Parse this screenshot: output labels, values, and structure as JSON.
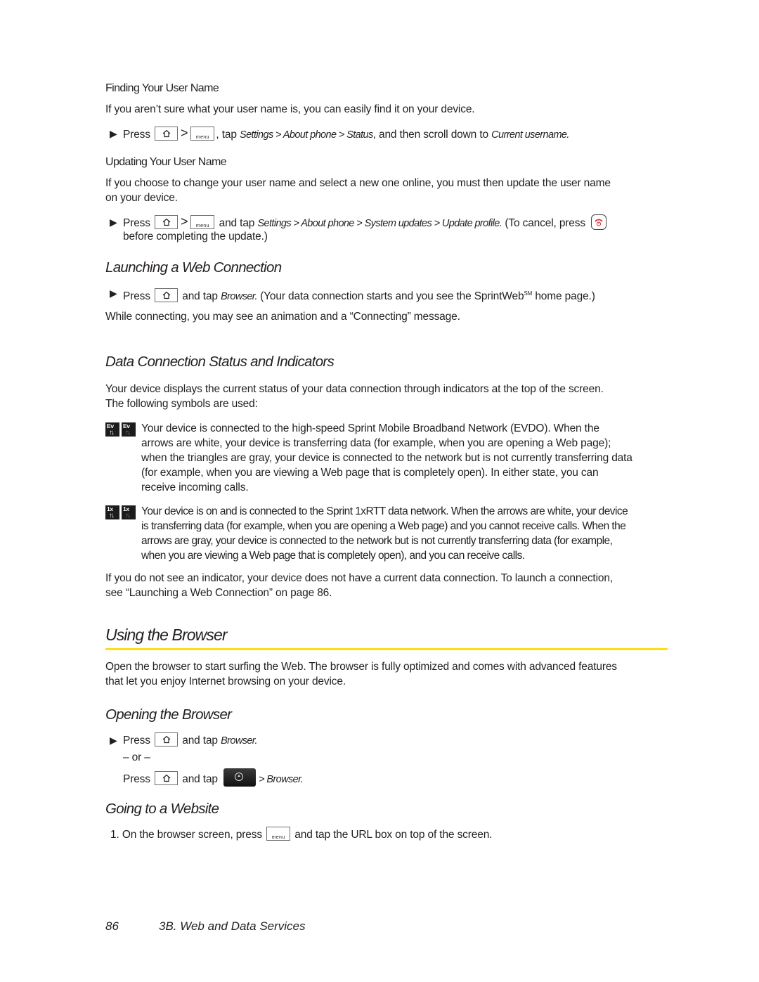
{
  "sections": {
    "finding": {
      "heading": "Finding Your User Name",
      "intro": "If you aren’t sure what your user name is, you can easily find it on your device.",
      "step": {
        "press": "Press",
        "home_key": "home-key",
        "sep": ">",
        "menu_key": "menu",
        "tap": ", tap",
        "path": "Settings > About phone > Status",
        "rest": ", and then scroll down to",
        "target": "Current username."
      }
    },
    "updating": {
      "heading": "Updating Your User Name",
      "intro_line1": "If you choose to change your user name and select a new one online, you must then update the user name",
      "intro_line2": "on your device.",
      "step": {
        "press": "Press",
        "sep": ">",
        "menu_key": "menu",
        "tap": "and tap",
        "path": "Settings > About phone > System updates > Update profile.",
        "cancel": "(To cancel, press",
        "line2": "before completing the update.)"
      }
    },
    "launching": {
      "heading": "Launching a Web Connection",
      "step": {
        "press": "Press",
        "tap": "and tap",
        "target": "Browser.",
        "rest": "(Your data connection starts and you see the SprintWeb",
        "sup": "SM",
        "rest2": "home page.)"
      },
      "note": "While connecting, you may see an animation and a “Connecting” message."
    },
    "status": {
      "heading": "Data Connection Status and Indicators",
      "intro_line1": "Your device displays the current status of your data connection through indicators at the top of the screen.",
      "intro_line2": "The following symbols are used:",
      "indicators": [
        {
          "label": "Ev",
          "lines": [
            "Your device is connected to the high-speed Sprint Mobile Broadband Network (EVDO). When the",
            "arrows are white, your device is transferring data (for example, when you are opening a Web page);",
            "when the triangles are gray, your device is connected to the network but is not currently transferring data",
            "(for example, when you are viewing a Web page that is completely open). In either state, you can",
            "receive incoming calls."
          ]
        },
        {
          "label": "1x",
          "lines": [
            "Your device is on and is connected to the Sprint 1xRTT data network. When the arrows are white, your device",
            "is transferring data (for example, when you are opening a Web page) and you cannot receive calls. When the",
            "arrows are gray, your device is connected to the network but is not currently transferring data (for example,",
            "when you are viewing a Web page that is completely open), and you can receive calls."
          ]
        }
      ],
      "outro_line1": "If you do not see an indicator, your device does not have a current data connection. To launch a connection,",
      "outro_line2": "see “Launching a Web Connection” on page 86."
    },
    "using": {
      "heading": "Using the Browser",
      "rule_color": "#ffde17",
      "intro_line1": "Open the browser to start surfing the Web. The browser is fully optimized and comes with advanced features",
      "intro_line2": "that let you enjoy Internet browsing on your device."
    },
    "opening": {
      "heading": "Opening the Browser",
      "step1": {
        "press": "Press",
        "tap": "and tap",
        "target": "Browser."
      },
      "or": "– or –",
      "step2": {
        "press": "Press",
        "tap": "and tap",
        "target": "> Browser."
      }
    },
    "going": {
      "heading": "Going to a Website",
      "step1": {
        "num": "1.",
        "text": "On the browser screen, press",
        "menu_key": "menu",
        "rest": "and tap the URL box on top of the screen."
      }
    }
  },
  "footer": {
    "page_number": "86",
    "chapter": "3B. Web and Data Services"
  }
}
